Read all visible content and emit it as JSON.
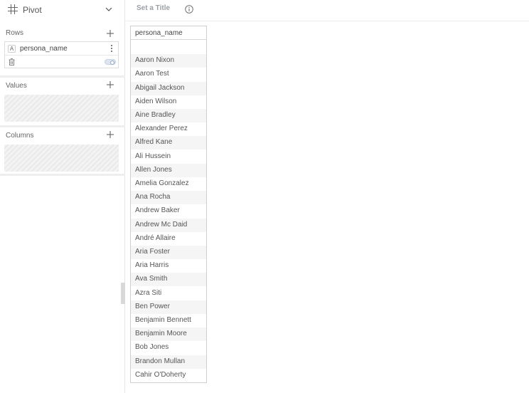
{
  "sidebar": {
    "title": "Pivot",
    "rows_label": "Rows",
    "values_label": "Values",
    "columns_label": "Columns",
    "row_field": {
      "type_badge": "A",
      "name": "persona_name"
    }
  },
  "header": {
    "title_placeholder": "Set a Title"
  },
  "pivot": {
    "column_header": "persona_name",
    "rows": [
      "",
      "Aaron Nixon",
      "Aaron Test",
      "Abigail Jackson",
      "Aiden Wilson",
      "Aine Bradley",
      "Alexander Perez",
      "Alfred Kane",
      "Ali Hussein",
      "Allen Jones",
      "Amelia Gonzalez",
      "Ana Rocha",
      "Andrew Baker",
      "Andrew Mc Daid",
      "André Allaire",
      "Aria Foster",
      "Aria Harris",
      "Ava Smith",
      "Azra Siti",
      "Ben Power",
      "Benjamin Bennett",
      "Benjamin Moore",
      "Bob Jones",
      "Brandon Mullan",
      "Cahir O'Doherty"
    ]
  }
}
